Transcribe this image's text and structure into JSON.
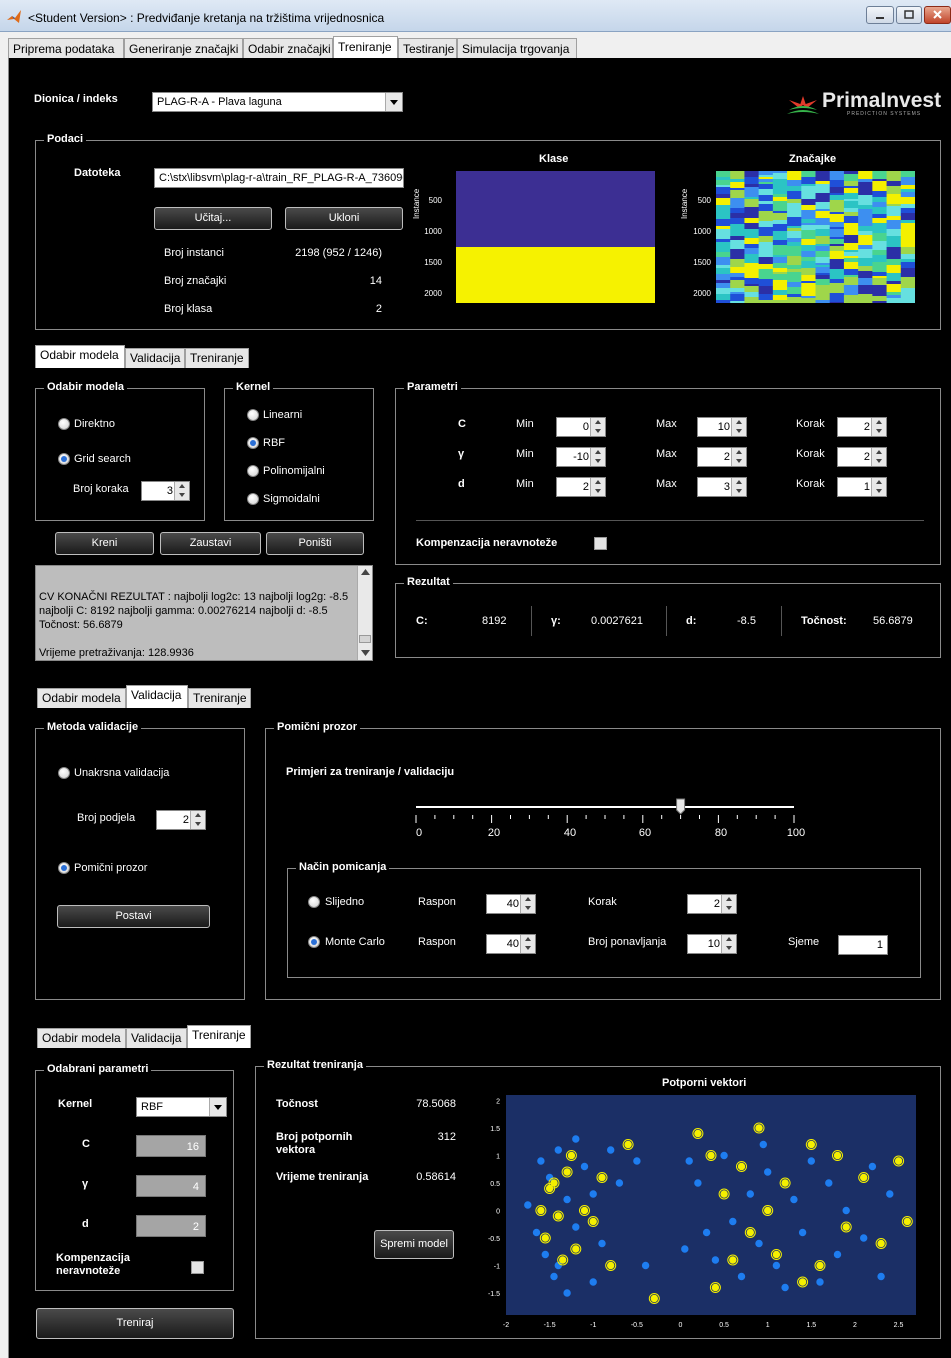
{
  "window": {
    "title": "<Student Version> : Predviđanje kretanja na tržištima vrijednosnica"
  },
  "main_tabs": [
    "Priprema podataka",
    "Generiranje značajki",
    "Odabir značajki",
    "Treniranje",
    "Testiranje",
    "Simulacija trgovanja"
  ],
  "active_main_tab": "Treniranje",
  "header": {
    "stock_label": "Dionica / indeks",
    "stock_value": "PLAG-R-A - Plava laguna",
    "logo_text": "PrimaInvest",
    "logo_sub": "PREDICTION SYSTEMS"
  },
  "podaci": {
    "title": "Podaci",
    "datoteka_label": "Datoteka",
    "datoteka_value": "C:\\stx\\libsvm\\plag-r-a\\train_RF_PLAG-R-A_736096",
    "load_button": "Učitaj...",
    "remove_button": "Ukloni",
    "rows": [
      {
        "label": "Broj instanci",
        "value": "2198 (952 / 1246)"
      },
      {
        "label": "Broj značajki",
        "value": "14"
      },
      {
        "label": "Broj klasa",
        "value": "2"
      }
    ],
    "plot_klase": {
      "title": "Klase",
      "ylabel": "Instance",
      "yticks": [
        "500",
        "1000",
        "1500",
        "2000"
      ]
    },
    "plot_znacajke": {
      "title": "Značajke",
      "ylabel": "Instance",
      "yticks": [
        "500",
        "1000",
        "1500",
        "2000"
      ]
    }
  },
  "subtabs": [
    "Odabir modela",
    "Validacija",
    "Treniranje"
  ],
  "odabir_modela": {
    "title": "Odabir modela",
    "options": [
      "Direktno",
      "Grid search"
    ],
    "selected": "Grid search",
    "steps_label": "Broj koraka",
    "steps_value": "3",
    "kernel_title": "Kernel",
    "kernels": [
      "Linearni",
      "RBF",
      "Polinomijalni",
      "Sigmoidalni"
    ],
    "selected_kernel": "RBF",
    "buttons": {
      "start": "Kreni",
      "stop": "Zaustavi",
      "cancel": "Poništi"
    },
    "log": [
      "CV KONAČNI REZULTAT : najbolji log2c: 13 najbolji log2g: -8.5",
      "najbolji C: 8192 najbolji gamma: 0.00276214 najbolji d: -8.5",
      "Točnost: 56.6879",
      "",
      "Vrijeme pretraživanja: 128.9936"
    ]
  },
  "parametri": {
    "title": "Parametri",
    "min_label": "Min",
    "max_label": "Max",
    "step_label": "Korak",
    "rows": [
      {
        "name": "C",
        "min": "0",
        "max": "10",
        "step": "2"
      },
      {
        "name": "γ",
        "min": "-10",
        "max": "2",
        "step": "2"
      },
      {
        "name": "d",
        "min": "2",
        "max": "3",
        "step": "1"
      }
    ],
    "imbalance_label": "Kompenzacija neravnoteže"
  },
  "rezultat": {
    "title": "Rezultat",
    "c_label": "C:",
    "c_value": "8192",
    "gamma_label": "γ:",
    "gamma_value": "0.0027621",
    "d_label": "d:",
    "d_value": "-8.5",
    "acc_label": "Točnost:",
    "acc_value": "56.6879"
  },
  "validacija": {
    "title": "Metoda validacije",
    "cv_label": "Unakrsna validacija",
    "splits_label": "Broj podjela",
    "splits_value": "2",
    "window_label": "Pomični prozor",
    "selected": "Pomični prozor",
    "set_button": "Postavi",
    "pomicni_title": "Pomični prozor",
    "ratio_label": "Primjeri za treniranje / validaciju",
    "slider_ticks": [
      "0",
      "20",
      "40",
      "60",
      "80",
      "100"
    ],
    "slider_value": 70,
    "nacin_title": "Način pomicanja",
    "sequential_label": "Slijedno",
    "monte_carlo_label": "Monte Carlo",
    "selected_mode": "Monte Carlo",
    "raspon_label": "Raspon",
    "seq_raspon": "40",
    "korak_label": "Korak",
    "seq_korak": "2",
    "mc_raspon": "40",
    "ponavljanja_label": "Broj ponavljanja",
    "mc_ponavljanja": "10",
    "sjeme_label": "Sjeme",
    "mc_sjeme": "1"
  },
  "treniranje": {
    "params_title": "Odabrani parametri",
    "kernel_label": "Kernel",
    "kernel_value": "RBF",
    "c_label": "C",
    "c_value": "16",
    "gamma_label": "γ",
    "gamma_value": "4",
    "d_label": "d",
    "d_value": "2",
    "imbalance_label": "Kompenzacija neravnoteže",
    "train_button": "Treniraj",
    "result_title": "Rezultat treniranja",
    "acc_label": "Točnost",
    "acc_value": "78.5068",
    "sv_label": "Broj potpornih vektora",
    "sv_value": "312",
    "time_label": "Vrijeme treniranja",
    "time_value": "0.58614",
    "save_button": "Spremi model"
  },
  "chart_data": {
    "type": "scatter",
    "title": "Potporni vektori",
    "xlim": [
      -2,
      2.7
    ],
    "ylim": [
      -1.9,
      2.1
    ],
    "xticks": [
      "-2",
      "-1.5",
      "-1",
      "-0.5",
      "0",
      "0.5",
      "1",
      "1.5",
      "2",
      "2.5"
    ],
    "yticks": [
      "2",
      "1.5",
      "1",
      "0.5",
      "0",
      "-0.5",
      "-1",
      "-1.5"
    ],
    "colors": {
      "class_a": "#1e7df0",
      "class_b": "#f5f000",
      "background": "#1b2f66"
    },
    "series": [
      {
        "values": [
          [
            -1.6,
            0.9
          ],
          [
            -1.5,
            0.6
          ],
          [
            -1.4,
            1.1
          ],
          [
            -1.3,
            0.2
          ],
          [
            -1.2,
            -0.3
          ],
          [
            -1.55,
            -0.8
          ],
          [
            -1.45,
            -1.2
          ],
          [
            -1.3,
            -1.5
          ],
          [
            -1.1,
            0.8
          ],
          [
            -1.0,
            0.3
          ],
          [
            -0.9,
            -0.6
          ],
          [
            -1.75,
            0.1
          ],
          [
            -1.65,
            -0.4
          ],
          [
            -1.2,
            1.3
          ],
          [
            -0.8,
            1.1
          ],
          [
            -0.7,
            0.5
          ],
          [
            -0.5,
            0.9
          ],
          [
            -0.4,
            -1.0
          ],
          [
            -1.4,
            -1.0
          ],
          [
            -1.0,
            -1.3
          ],
          [
            0.1,
            0.9
          ],
          [
            0.2,
            0.5
          ],
          [
            0.3,
            -0.4
          ],
          [
            0.4,
            -0.9
          ],
          [
            0.5,
            1.0
          ],
          [
            0.6,
            -0.2
          ],
          [
            0.7,
            -1.2
          ],
          [
            0.8,
            0.3
          ],
          [
            0.9,
            -0.6
          ],
          [
            1.0,
            0.7
          ],
          [
            1.1,
            -1.0
          ],
          [
            1.3,
            0.2
          ],
          [
            1.4,
            -0.4
          ],
          [
            1.5,
            0.9
          ],
          [
            1.6,
            -1.3
          ],
          [
            1.7,
            0.5
          ],
          [
            1.8,
            -0.8
          ],
          [
            1.9,
            0.0
          ],
          [
            2.1,
            -0.5
          ],
          [
            2.2,
            0.8
          ],
          [
            2.3,
            -1.2
          ],
          [
            2.4,
            0.3
          ],
          [
            1.2,
            -1.4
          ],
          [
            0.95,
            1.2
          ],
          [
            0.05,
            -0.7
          ]
        ]
      },
      {
        "values": [
          [
            -1.5,
            0.4
          ],
          [
            -1.4,
            -0.1
          ],
          [
            -1.3,
            0.7
          ],
          [
            -1.2,
            -0.7
          ],
          [
            -1.1,
            0.0
          ],
          [
            -1.55,
            -0.5
          ],
          [
            -1.45,
            0.5
          ],
          [
            -1.35,
            -0.9
          ],
          [
            -1.0,
            -0.2
          ],
          [
            -0.9,
            0.6
          ],
          [
            -0.8,
            -1.0
          ],
          [
            -0.6,
            1.2
          ],
          [
            -1.25,
            1.0
          ],
          [
            -1.6,
            0.0
          ],
          [
            0.2,
            1.4
          ],
          [
            0.35,
            1.0
          ],
          [
            0.5,
            0.3
          ],
          [
            0.6,
            -0.9
          ],
          [
            0.7,
            0.8
          ],
          [
            0.8,
            -0.4
          ],
          [
            0.9,
            1.5
          ],
          [
            1.0,
            0.0
          ],
          [
            1.1,
            -0.8
          ],
          [
            1.2,
            0.5
          ],
          [
            1.5,
            1.2
          ],
          [
            1.6,
            -1.0
          ],
          [
            1.8,
            1.0
          ],
          [
            1.9,
            -0.3
          ],
          [
            2.1,
            0.6
          ],
          [
            2.3,
            -0.6
          ],
          [
            2.5,
            0.9
          ],
          [
            2.6,
            -0.2
          ],
          [
            1.4,
            -1.3
          ],
          [
            0.4,
            -1.4
          ],
          [
            -0.3,
            -1.6
          ]
        ]
      }
    ]
  }
}
